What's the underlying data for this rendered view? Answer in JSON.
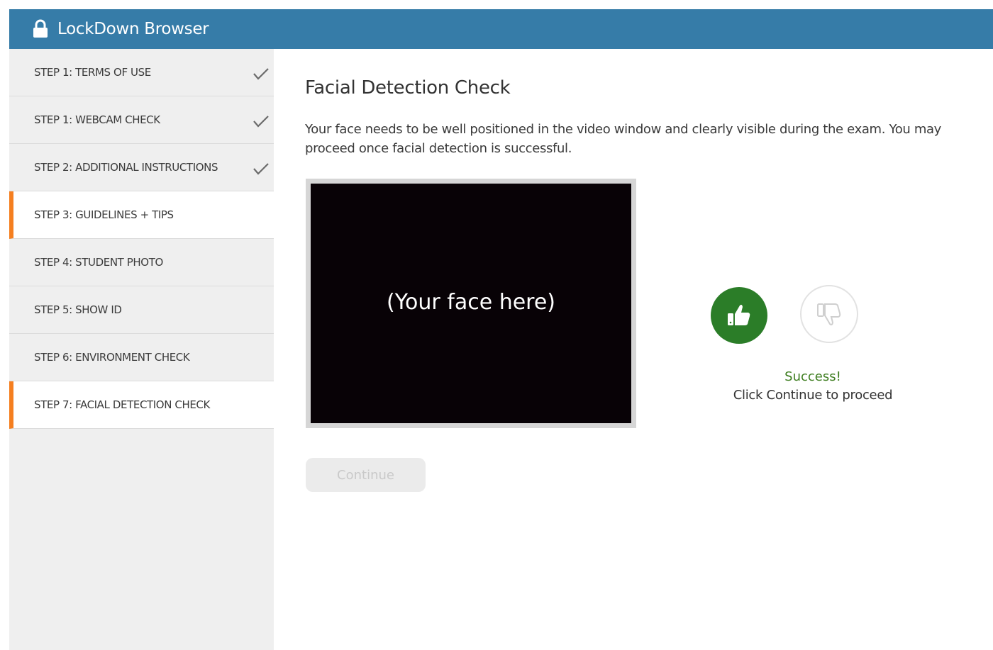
{
  "header": {
    "title": "LockDown Browser",
    "icon": "lock-icon",
    "background": "#367ca8"
  },
  "sidebar": {
    "accent_color": "#f57f20",
    "steps": [
      {
        "label": "STEP 1: TERMS OF USE",
        "completed": true,
        "active": false
      },
      {
        "label": "STEP 1: WEBCAM CHECK",
        "completed": true,
        "active": false
      },
      {
        "label": "STEP 2: ADDITIONAL INSTRUCTIONS",
        "completed": true,
        "active": false
      },
      {
        "label": "STEP 3: GUIDELINES + TIPS",
        "completed": false,
        "active": true
      },
      {
        "label": "STEP 4: STUDENT PHOTO",
        "completed": false,
        "active": false
      },
      {
        "label": "STEP 5: SHOW ID",
        "completed": false,
        "active": false
      },
      {
        "label": "STEP 6: ENVIRONMENT CHECK",
        "completed": false,
        "active": false
      },
      {
        "label": "STEP 7: FACIAL DETECTION CHECK",
        "completed": false,
        "active": true
      }
    ]
  },
  "main": {
    "title": "Facial Detection Check",
    "description": "Your face needs to be well positioned in the video window and clearly visible during the exam. You may proceed once facial detection is successful.",
    "video_placeholder": "(Your face here)",
    "thumbs_up": {
      "icon": "thumbs-up-icon",
      "selected": true,
      "color": "#2b7d28"
    },
    "thumbs_down": {
      "icon": "thumbs-down-icon",
      "selected": false
    },
    "status_title": "Success!",
    "status_message": "Click Continue to proceed",
    "continue_label": "Continue"
  }
}
